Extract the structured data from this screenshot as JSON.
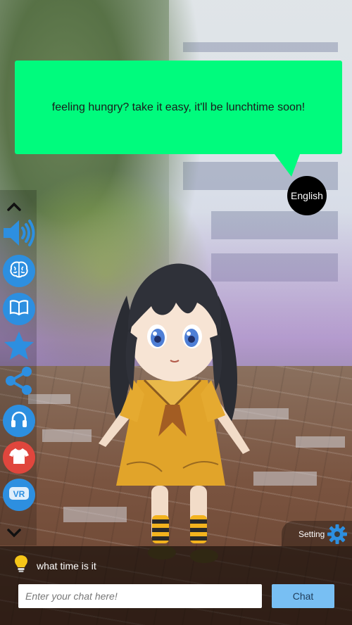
{
  "speech": {
    "text": "feeling hungry? take it easy, it'll be lunchtime soon!"
  },
  "language_button": {
    "label": "English"
  },
  "toolbar": {
    "items": [
      {
        "name": "scroll-up",
        "icon": "chevron-up-icon"
      },
      {
        "name": "voice",
        "icon": "speaker-icon"
      },
      {
        "name": "brain",
        "icon": "brain-icon"
      },
      {
        "name": "book",
        "icon": "book-icon"
      },
      {
        "name": "favorite",
        "icon": "star-icon"
      },
      {
        "name": "share",
        "icon": "share-icon"
      },
      {
        "name": "headphones",
        "icon": "headphones-icon"
      },
      {
        "name": "outfit",
        "icon": "shirt-icon"
      },
      {
        "name": "vr",
        "icon": "vr-icon",
        "label": "VR"
      },
      {
        "name": "scroll-down",
        "icon": "chevron-down-icon"
      }
    ]
  },
  "setting": {
    "label": "Setting",
    "icon": "gear-icon"
  },
  "chat": {
    "last_message": "what time is it",
    "input_placeholder": "Enter your chat here!",
    "input_value": "",
    "send_label": "Chat",
    "hint_icon": "lightbulb-icon"
  },
  "colors": {
    "bubble": "#00fb7d",
    "toolbar_button": "#2d8fe0",
    "outfit_button": "#e0463d",
    "chat_button": "#78bff3"
  }
}
